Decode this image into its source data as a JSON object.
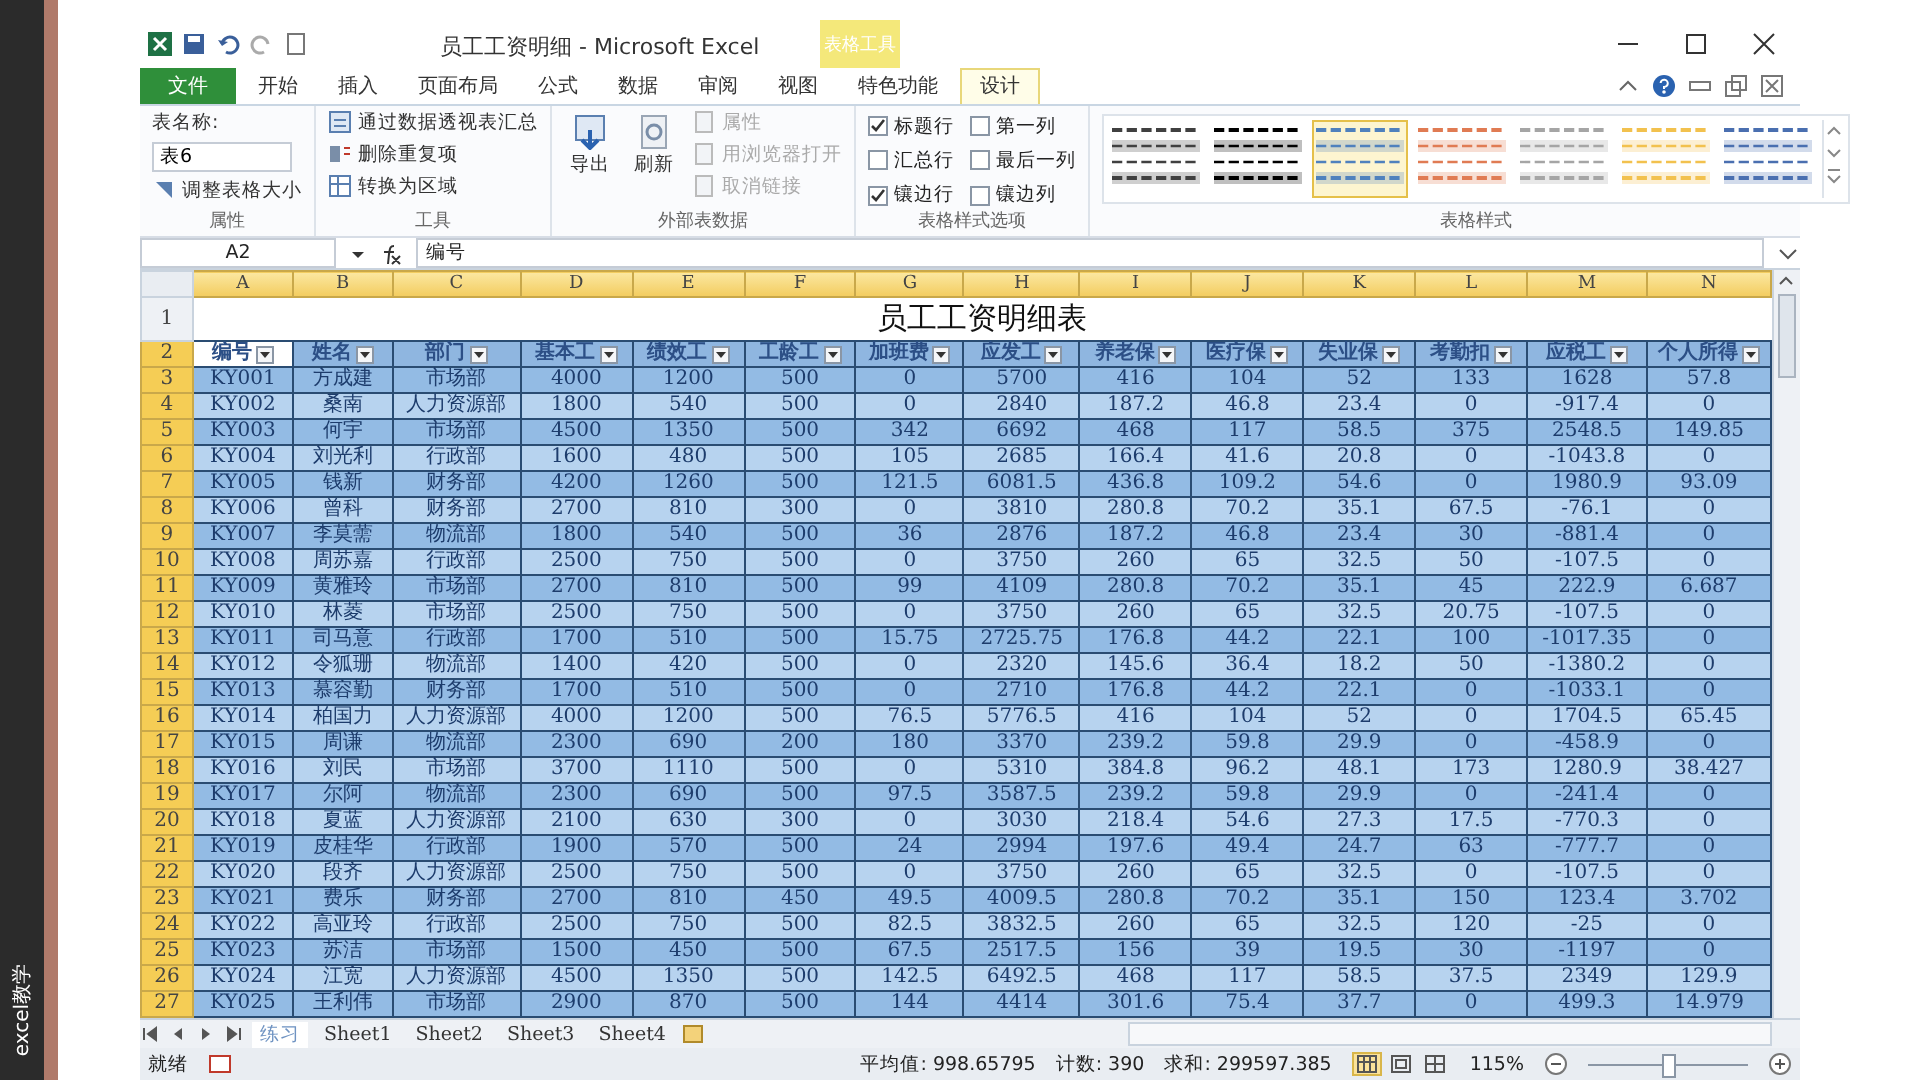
{
  "side_label": "excel教学",
  "window": {
    "title": "员工工资明细 - Microsoft Excel",
    "context_tab": "表格工具"
  },
  "ribbon_tabs": [
    {
      "label": "文件",
      "kind": "file",
      "selected": false
    },
    {
      "label": "开始",
      "kind": "tab",
      "selected": false
    },
    {
      "label": "插入",
      "kind": "tab",
      "selected": false
    },
    {
      "label": "页面布局",
      "kind": "tab",
      "selected": false
    },
    {
      "label": "公式",
      "kind": "tab",
      "selected": false
    },
    {
      "label": "数据",
      "kind": "tab",
      "selected": false
    },
    {
      "label": "审阅",
      "kind": "tab",
      "selected": false
    },
    {
      "label": "视图",
      "kind": "tab",
      "selected": false
    },
    {
      "label": "特色功能",
      "kind": "tab",
      "selected": false
    },
    {
      "label": "设计",
      "kind": "tab",
      "selected": true
    }
  ],
  "ribbon": {
    "properties": {
      "label": "属性",
      "name_label": "表名称:",
      "name_value": "表6",
      "resize": "调整表格大小"
    },
    "tools": {
      "label": "工具",
      "items": [
        "通过数据透视表汇总",
        "删除重复项",
        "转换为区域"
      ]
    },
    "external": {
      "label": "外部表数据",
      "large": [
        {
          "label": "导出",
          "disabled": false
        },
        {
          "label": "刷新",
          "disabled": false
        }
      ],
      "small": [
        {
          "label": "属性",
          "disabled": true
        },
        {
          "label": "用浏览器打开",
          "disabled": true
        },
        {
          "label": "取消链接",
          "disabled": true
        }
      ]
    },
    "style_options": {
      "label": "表格样式选项",
      "options": [
        {
          "label": "标题行",
          "kind": "header_row",
          "checked": true
        },
        {
          "label": "第一列",
          "kind": "first_column",
          "checked": false
        },
        {
          "label": "汇总行",
          "kind": "total_row",
          "checked": false
        },
        {
          "label": "最后一列",
          "kind": "last_column",
          "checked": false
        },
        {
          "label": "镶边行",
          "kind": "banded_rows",
          "checked": true
        },
        {
          "label": "镶边列",
          "kind": "banded_columns",
          "checked": false
        }
      ]
    },
    "styles": {
      "label": "表格样式",
      "items": [
        {
          "color": "#404040",
          "selected": false
        },
        {
          "color": "#000000",
          "selected": false
        },
        {
          "color": "#4f81bd",
          "selected": true
        },
        {
          "color": "#e07b53",
          "selected": false
        },
        {
          "color": "#a5a5a5",
          "selected": false
        },
        {
          "color": "#f2c14e",
          "selected": false
        },
        {
          "color": "#4a6fb0",
          "selected": false
        }
      ]
    }
  },
  "formula_bar": {
    "cell": "A2",
    "value": "编号"
  },
  "sheet": {
    "columns": [
      "A",
      "B",
      "C",
      "D",
      "E",
      "F",
      "G",
      "H",
      "I",
      "J",
      "K",
      "L",
      "M",
      "N"
    ],
    "title_row": "1",
    "title": "员工工资明细表",
    "header_row": "2",
    "headers": [
      {
        "label": "编号",
        "active": true
      },
      {
        "label": "姓名",
        "active": false
      },
      {
        "label": "部门",
        "active": false
      },
      {
        "label": "基本工",
        "active": false
      },
      {
        "label": "绩效工",
        "active": false
      },
      {
        "label": "工龄工",
        "active": false
      },
      {
        "label": "加班费",
        "active": false
      },
      {
        "label": "应发工",
        "active": false
      },
      {
        "label": "养老保",
        "active": false
      },
      {
        "label": "医疗保",
        "active": false
      },
      {
        "label": "失业保",
        "active": false
      },
      {
        "label": "考勤扣",
        "active": false
      },
      {
        "label": "应税工",
        "active": false
      },
      {
        "label": "个人所得",
        "active": false
      }
    ],
    "rows": [
      {
        "row_number": "3",
        "cells": [
          "KY001",
          "方成建",
          "市场部",
          "4000",
          "1200",
          "500",
          "0",
          "5700",
          "416",
          "104",
          "52",
          "133",
          "1628",
          "57.8"
        ]
      },
      {
        "row_number": "4",
        "cells": [
          "KY002",
          "桑南",
          "人力资源部",
          "1800",
          "540",
          "500",
          "0",
          "2840",
          "187.2",
          "46.8",
          "23.4",
          "0",
          "-917.4",
          "0"
        ]
      },
      {
        "row_number": "5",
        "cells": [
          "KY003",
          "何宇",
          "市场部",
          "4500",
          "1350",
          "500",
          "342",
          "6692",
          "468",
          "117",
          "58.5",
          "375",
          "2548.5",
          "149.85"
        ]
      },
      {
        "row_number": "6",
        "cells": [
          "KY004",
          "刘光利",
          "行政部",
          "1600",
          "480",
          "500",
          "105",
          "2685",
          "166.4",
          "41.6",
          "20.8",
          "0",
          "-1043.8",
          "0"
        ]
      },
      {
        "row_number": "7",
        "cells": [
          "KY005",
          "钱新",
          "财务部",
          "4200",
          "1260",
          "500",
          "121.5",
          "6081.5",
          "436.8",
          "109.2",
          "54.6",
          "0",
          "1980.9",
          "93.09"
        ]
      },
      {
        "row_number": "8",
        "cells": [
          "KY006",
          "曾科",
          "财务部",
          "2700",
          "810",
          "300",
          "0",
          "3810",
          "280.8",
          "70.2",
          "35.1",
          "67.5",
          "-76.1",
          "0"
        ]
      },
      {
        "row_number": "9",
        "cells": [
          "KY007",
          "李莫薷",
          "物流部",
          "1800",
          "540",
          "500",
          "36",
          "2876",
          "187.2",
          "46.8",
          "23.4",
          "30",
          "-881.4",
          "0"
        ]
      },
      {
        "row_number": "10",
        "cells": [
          "KY008",
          "周苏嘉",
          "行政部",
          "2500",
          "750",
          "500",
          "0",
          "3750",
          "260",
          "65",
          "32.5",
          "50",
          "-107.5",
          "0"
        ]
      },
      {
        "row_number": "11",
        "cells": [
          "KY009",
          "黄雅玲",
          "市场部",
          "2700",
          "810",
          "500",
          "99",
          "4109",
          "280.8",
          "70.2",
          "35.1",
          "45",
          "222.9",
          "6.687"
        ]
      },
      {
        "row_number": "12",
        "cells": [
          "KY010",
          "林菱",
          "市场部",
          "2500",
          "750",
          "500",
          "0",
          "3750",
          "260",
          "65",
          "32.5",
          "20.75",
          "-107.5",
          "0"
        ]
      },
      {
        "row_number": "13",
        "cells": [
          "KY011",
          "司马意",
          "行政部",
          "1700",
          "510",
          "500",
          "15.75",
          "2725.75",
          "176.8",
          "44.2",
          "22.1",
          "100",
          "-1017.35",
          "0"
        ]
      },
      {
        "row_number": "14",
        "cells": [
          "KY012",
          "令狐珊",
          "物流部",
          "1400",
          "420",
          "500",
          "0",
          "2320",
          "145.6",
          "36.4",
          "18.2",
          "50",
          "-1380.2",
          "0"
        ]
      },
      {
        "row_number": "15",
        "cells": [
          "KY013",
          "慕容勤",
          "财务部",
          "1700",
          "510",
          "500",
          "0",
          "2710",
          "176.8",
          "44.2",
          "22.1",
          "0",
          "-1033.1",
          "0"
        ]
      },
      {
        "row_number": "16",
        "cells": [
          "KY014",
          "柏国力",
          "人力资源部",
          "4000",
          "1200",
          "500",
          "76.5",
          "5776.5",
          "416",
          "104",
          "52",
          "0",
          "1704.5",
          "65.45"
        ]
      },
      {
        "row_number": "17",
        "cells": [
          "KY015",
          "周谦",
          "物流部",
          "2300",
          "690",
          "200",
          "180",
          "3370",
          "239.2",
          "59.8",
          "29.9",
          "0",
          "-458.9",
          "0"
        ]
      },
      {
        "row_number": "18",
        "cells": [
          "KY016",
          "刘民",
          "市场部",
          "3700",
          "1110",
          "500",
          "0",
          "5310",
          "384.8",
          "96.2",
          "48.1",
          "173",
          "1280.9",
          "38.427"
        ]
      },
      {
        "row_number": "19",
        "cells": [
          "KY017",
          "尔阿",
          "物流部",
          "2300",
          "690",
          "500",
          "97.5",
          "3587.5",
          "239.2",
          "59.8",
          "29.9",
          "0",
          "-241.4",
          "0"
        ]
      },
      {
        "row_number": "20",
        "cells": [
          "KY018",
          "夏蓝",
          "人力资源部",
          "2100",
          "630",
          "300",
          "0",
          "3030",
          "218.4",
          "54.6",
          "27.3",
          "17.5",
          "-770.3",
          "0"
        ]
      },
      {
        "row_number": "21",
        "cells": [
          "KY019",
          "皮桂华",
          "行政部",
          "1900",
          "570",
          "500",
          "24",
          "2994",
          "197.6",
          "49.4",
          "24.7",
          "63",
          "-777.7",
          "0"
        ]
      },
      {
        "row_number": "22",
        "cells": [
          "KY020",
          "段齐",
          "人力资源部",
          "2500",
          "750",
          "500",
          "0",
          "3750",
          "260",
          "65",
          "32.5",
          "0",
          "-107.5",
          "0"
        ]
      },
      {
        "row_number": "23",
        "cells": [
          "KY021",
          "费乐",
          "财务部",
          "2700",
          "810",
          "450",
          "49.5",
          "4009.5",
          "280.8",
          "70.2",
          "35.1",
          "150",
          "123.4",
          "3.702"
        ]
      },
      {
        "row_number": "24",
        "cells": [
          "KY022",
          "高亚玲",
          "行政部",
          "2500",
          "750",
          "500",
          "82.5",
          "3832.5",
          "260",
          "65",
          "32.5",
          "120",
          "-25",
          "0"
        ]
      },
      {
        "row_number": "25",
        "cells": [
          "KY023",
          "苏洁",
          "市场部",
          "1500",
          "450",
          "500",
          "67.5",
          "2517.5",
          "156",
          "39",
          "19.5",
          "30",
          "-1197",
          "0"
        ]
      },
      {
        "row_number": "26",
        "cells": [
          "KY024",
          "江宽",
          "人力资源部",
          "4500",
          "1350",
          "500",
          "142.5",
          "6492.5",
          "468",
          "117",
          "58.5",
          "37.5",
          "2349",
          "129.9"
        ]
      },
      {
        "row_number": "27",
        "cells": [
          "KY025",
          "王利伟",
          "市场部",
          "2900",
          "870",
          "500",
          "144",
          "4414",
          "301.6",
          "75.4",
          "37.7",
          "0",
          "499.3",
          "14.979"
        ]
      }
    ]
  },
  "sheet_tabs": [
    {
      "label": "练习",
      "selected": true
    },
    {
      "label": "Sheet1",
      "selected": false
    },
    {
      "label": "Sheet2",
      "selected": false
    },
    {
      "label": "Sheet3",
      "selected": false
    },
    {
      "label": "Sheet4",
      "selected": false
    }
  ],
  "status_bar": {
    "mode": "就绪",
    "average": "平均值: 998.65795",
    "count": "计数: 390",
    "sum": "求和: 299597.385",
    "views": [
      {
        "kind": "normal",
        "selected": true
      },
      {
        "kind": "page_layout",
        "selected": false
      },
      {
        "kind": "page_break",
        "selected": false
      }
    ],
    "zoom": "115%",
    "zoom_slider": {
      "level": 0.5
    }
  }
}
